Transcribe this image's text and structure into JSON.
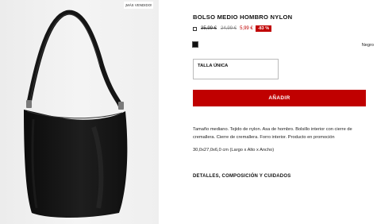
{
  "product_image": {
    "badge": "¡MÁS VENDIDO!"
  },
  "product": {
    "title": "BOLSO MEDIO HOMBRO NYLON",
    "price_original": "35,99 €",
    "price_previous": "24,99 €",
    "price_sale": "5,99 €",
    "discount": "-83 %",
    "color_name": "Negro",
    "swatch_color": "#111111",
    "size_label": "TALLA ÚNICA",
    "add_button": "AÑADIR",
    "description": "Tamaño mediano. Tejido de nylon. Asa de hombro. Bolsillo interior con cierre de cremallera. Cierre de cremallera. Forro interior. Producto en promoción",
    "dimensions": "30,0x27,0x6,0 cm (Largo x Alto x Ancho)",
    "details_link": "DETALLES, COMPOSICIÓN Y CUIDADOS"
  },
  "colors": {
    "accent_red": "#c00000"
  }
}
